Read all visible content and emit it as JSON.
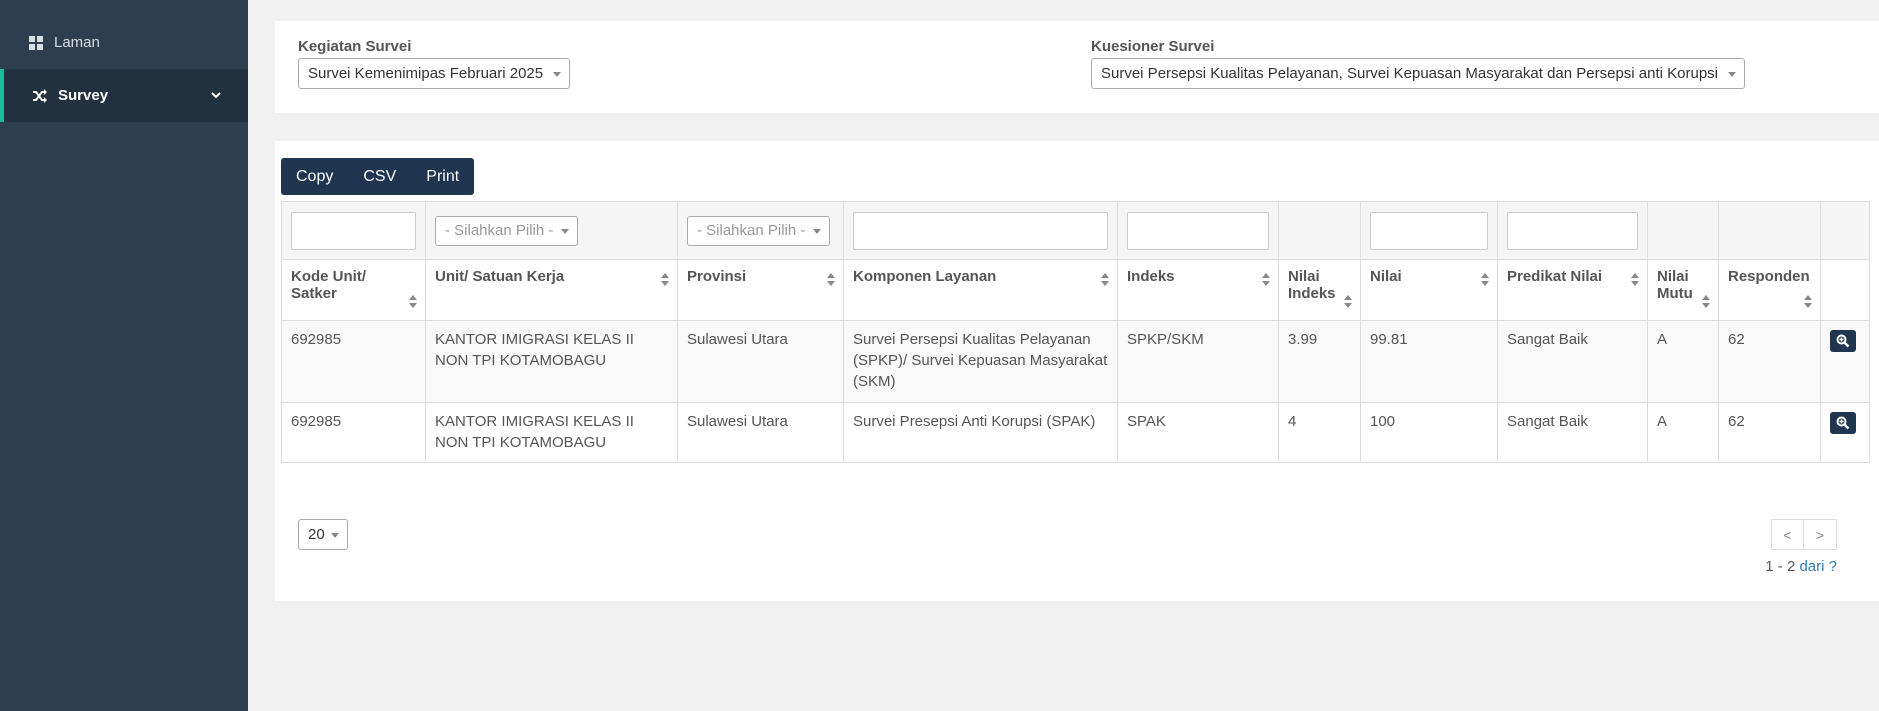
{
  "sidebar": {
    "items": [
      {
        "label": "Laman",
        "icon": "dashboard-icon"
      },
      {
        "label": "Survey",
        "icon": "shuffle-icon"
      }
    ],
    "accent": "#1abb9c"
  },
  "filters": {
    "kegiatan_label": "Kegiatan Survei",
    "kegiatan_value": "Survei Kemenimipas Februari 2025",
    "kuesioner_label": "Kuesioner Survei",
    "kuesioner_value": "Survei Persepsi Kualitas Pelayanan, Survei Kepuasan Masyarakat dan Persepsi anti Korupsi"
  },
  "toolbar": {
    "copy": "Copy",
    "csv": "CSV",
    "print": "Print"
  },
  "table": {
    "filter_placeholder": "- Silahkan Pilih -",
    "headers": [
      "Kode Unit/ Satker",
      "Unit/ Satuan Kerja",
      "Provinsi",
      "Komponen Layanan",
      "Indeks",
      "Nilai Indeks",
      "Nilai",
      "Predikat Nilai",
      "Nilai Mutu",
      "Responden"
    ],
    "rows": [
      {
        "kode": "692985",
        "unit": "KANTOR IMIGRASI KELAS II NON TPI KOTAMOBAGU",
        "provinsi": "Sulawesi Utara",
        "komponen": "Survei Persepsi Kualitas Pelayanan (SPKP)/ Survei Kepuasan Masyarakat (SKM)",
        "indeks": "SPKP/SKM",
        "nilai_indeks": "3.99",
        "nilai": "99.81",
        "predikat": "Sangat Baik",
        "mutu": "A",
        "responden": "62"
      },
      {
        "kode": "692985",
        "unit": "KANTOR IMIGRASI KELAS II NON TPI KOTAMOBAGU",
        "provinsi": "Sulawesi Utara",
        "komponen": "Survei Presepsi Anti Korupsi (SPAK)",
        "indeks": "SPAK",
        "nilai_indeks": "4",
        "nilai": "100",
        "predikat": "Sangat Baik",
        "mutu": "A",
        "responden": "62"
      }
    ]
  },
  "pagination": {
    "page_size": "20",
    "prev": "<",
    "next": ">",
    "range": "1 - 2",
    "of_label": "dari ?"
  }
}
